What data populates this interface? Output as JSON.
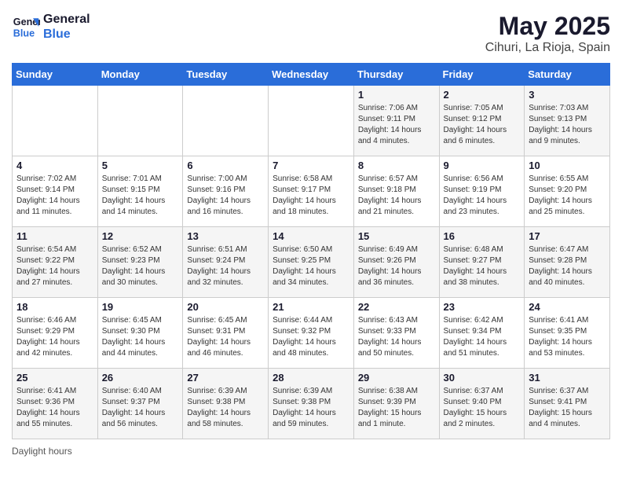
{
  "header": {
    "logo_line1": "General",
    "logo_line2": "Blue",
    "month_title": "May 2025",
    "location": "Cihuri, La Rioja, Spain"
  },
  "days_of_week": [
    "Sunday",
    "Monday",
    "Tuesday",
    "Wednesday",
    "Thursday",
    "Friday",
    "Saturday"
  ],
  "footer": {
    "daylight_label": "Daylight hours"
  },
  "weeks": [
    [
      {
        "day": "",
        "info": ""
      },
      {
        "day": "",
        "info": ""
      },
      {
        "day": "",
        "info": ""
      },
      {
        "day": "",
        "info": ""
      },
      {
        "day": "1",
        "info": "Sunrise: 7:06 AM\nSunset: 9:11 PM\nDaylight: 14 hours\nand 4 minutes."
      },
      {
        "day": "2",
        "info": "Sunrise: 7:05 AM\nSunset: 9:12 PM\nDaylight: 14 hours\nand 6 minutes."
      },
      {
        "day": "3",
        "info": "Sunrise: 7:03 AM\nSunset: 9:13 PM\nDaylight: 14 hours\nand 9 minutes."
      }
    ],
    [
      {
        "day": "4",
        "info": "Sunrise: 7:02 AM\nSunset: 9:14 PM\nDaylight: 14 hours\nand 11 minutes."
      },
      {
        "day": "5",
        "info": "Sunrise: 7:01 AM\nSunset: 9:15 PM\nDaylight: 14 hours\nand 14 minutes."
      },
      {
        "day": "6",
        "info": "Sunrise: 7:00 AM\nSunset: 9:16 PM\nDaylight: 14 hours\nand 16 minutes."
      },
      {
        "day": "7",
        "info": "Sunrise: 6:58 AM\nSunset: 9:17 PM\nDaylight: 14 hours\nand 18 minutes."
      },
      {
        "day": "8",
        "info": "Sunrise: 6:57 AM\nSunset: 9:18 PM\nDaylight: 14 hours\nand 21 minutes."
      },
      {
        "day": "9",
        "info": "Sunrise: 6:56 AM\nSunset: 9:19 PM\nDaylight: 14 hours\nand 23 minutes."
      },
      {
        "day": "10",
        "info": "Sunrise: 6:55 AM\nSunset: 9:20 PM\nDaylight: 14 hours\nand 25 minutes."
      }
    ],
    [
      {
        "day": "11",
        "info": "Sunrise: 6:54 AM\nSunset: 9:22 PM\nDaylight: 14 hours\nand 27 minutes."
      },
      {
        "day": "12",
        "info": "Sunrise: 6:52 AM\nSunset: 9:23 PM\nDaylight: 14 hours\nand 30 minutes."
      },
      {
        "day": "13",
        "info": "Sunrise: 6:51 AM\nSunset: 9:24 PM\nDaylight: 14 hours\nand 32 minutes."
      },
      {
        "day": "14",
        "info": "Sunrise: 6:50 AM\nSunset: 9:25 PM\nDaylight: 14 hours\nand 34 minutes."
      },
      {
        "day": "15",
        "info": "Sunrise: 6:49 AM\nSunset: 9:26 PM\nDaylight: 14 hours\nand 36 minutes."
      },
      {
        "day": "16",
        "info": "Sunrise: 6:48 AM\nSunset: 9:27 PM\nDaylight: 14 hours\nand 38 minutes."
      },
      {
        "day": "17",
        "info": "Sunrise: 6:47 AM\nSunset: 9:28 PM\nDaylight: 14 hours\nand 40 minutes."
      }
    ],
    [
      {
        "day": "18",
        "info": "Sunrise: 6:46 AM\nSunset: 9:29 PM\nDaylight: 14 hours\nand 42 minutes."
      },
      {
        "day": "19",
        "info": "Sunrise: 6:45 AM\nSunset: 9:30 PM\nDaylight: 14 hours\nand 44 minutes."
      },
      {
        "day": "20",
        "info": "Sunrise: 6:45 AM\nSunset: 9:31 PM\nDaylight: 14 hours\nand 46 minutes."
      },
      {
        "day": "21",
        "info": "Sunrise: 6:44 AM\nSunset: 9:32 PM\nDaylight: 14 hours\nand 48 minutes."
      },
      {
        "day": "22",
        "info": "Sunrise: 6:43 AM\nSunset: 9:33 PM\nDaylight: 14 hours\nand 50 minutes."
      },
      {
        "day": "23",
        "info": "Sunrise: 6:42 AM\nSunset: 9:34 PM\nDaylight: 14 hours\nand 51 minutes."
      },
      {
        "day": "24",
        "info": "Sunrise: 6:41 AM\nSunset: 9:35 PM\nDaylight: 14 hours\nand 53 minutes."
      }
    ],
    [
      {
        "day": "25",
        "info": "Sunrise: 6:41 AM\nSunset: 9:36 PM\nDaylight: 14 hours\nand 55 minutes."
      },
      {
        "day": "26",
        "info": "Sunrise: 6:40 AM\nSunset: 9:37 PM\nDaylight: 14 hours\nand 56 minutes."
      },
      {
        "day": "27",
        "info": "Sunrise: 6:39 AM\nSunset: 9:38 PM\nDaylight: 14 hours\nand 58 minutes."
      },
      {
        "day": "28",
        "info": "Sunrise: 6:39 AM\nSunset: 9:38 PM\nDaylight: 14 hours\nand 59 minutes."
      },
      {
        "day": "29",
        "info": "Sunrise: 6:38 AM\nSunset: 9:39 PM\nDaylight: 15 hours\nand 1 minute."
      },
      {
        "day": "30",
        "info": "Sunrise: 6:37 AM\nSunset: 9:40 PM\nDaylight: 15 hours\nand 2 minutes."
      },
      {
        "day": "31",
        "info": "Sunrise: 6:37 AM\nSunset: 9:41 PM\nDaylight: 15 hours\nand 4 minutes."
      }
    ]
  ]
}
